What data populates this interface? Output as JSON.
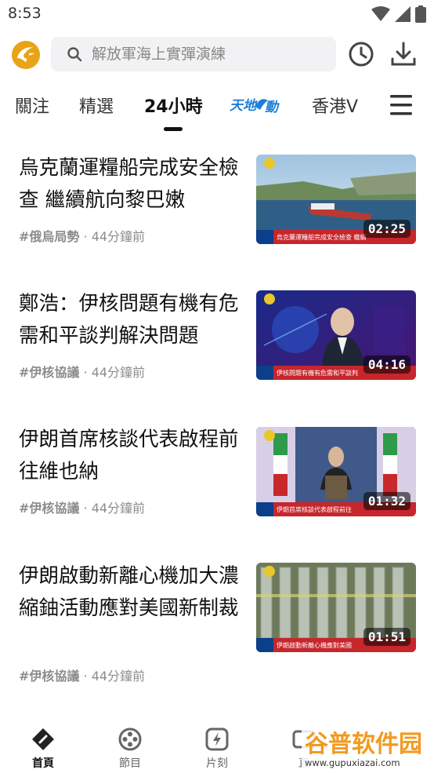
{
  "status_bar": {
    "time": "8:53"
  },
  "search": {
    "placeholder": "解放軍海上實彈演練"
  },
  "tabs": [
    {
      "label": "關注"
    },
    {
      "label": "精選"
    },
    {
      "label": "24小時"
    },
    {
      "label": "天地互動"
    },
    {
      "label": "香港V"
    }
  ],
  "feed": [
    {
      "title": "烏克蘭運糧船完成安全檢查 繼續航向黎巴嫩",
      "tag": "#俄烏局勢",
      "time": "· 44分鐘前",
      "duration": "02:25",
      "thumb_caption": "烏克蘭運糧船完成安全檢查 繼續"
    },
    {
      "title": "鄭浩：伊核問題有機有危 需和平談判解決問題",
      "tag": "#伊核協議",
      "time": "· 44分鐘前",
      "duration": "04:16",
      "thumb_caption": "伊核問題有機有危需和平談判"
    },
    {
      "title": "伊朗首席核談代表啟程前往維也納",
      "tag": "#伊核協議",
      "time": "· 44分鐘前",
      "duration": "01:32",
      "thumb_caption": "伊朗首席核談代表啟程前往"
    },
    {
      "title": "伊朗啟動新離心機加大濃縮鈾活動應對美國新制裁",
      "tag": "#伊核協議",
      "time": "· 44分鐘前",
      "duration": "01:51",
      "thumb_caption": "伊朗啟動新離心機應對美國"
    }
  ],
  "bottom_nav": [
    {
      "label": "首頁"
    },
    {
      "label": "節目"
    },
    {
      "label": "片刻"
    },
    {
      "label": "直"
    }
  ],
  "watermark": {
    "name": "谷普软件园",
    "url": "www.gupuxiazai.com"
  },
  "colors": {
    "active": "#111111",
    "meta": "#8c8c8c",
    "logo": "#e8a318"
  }
}
